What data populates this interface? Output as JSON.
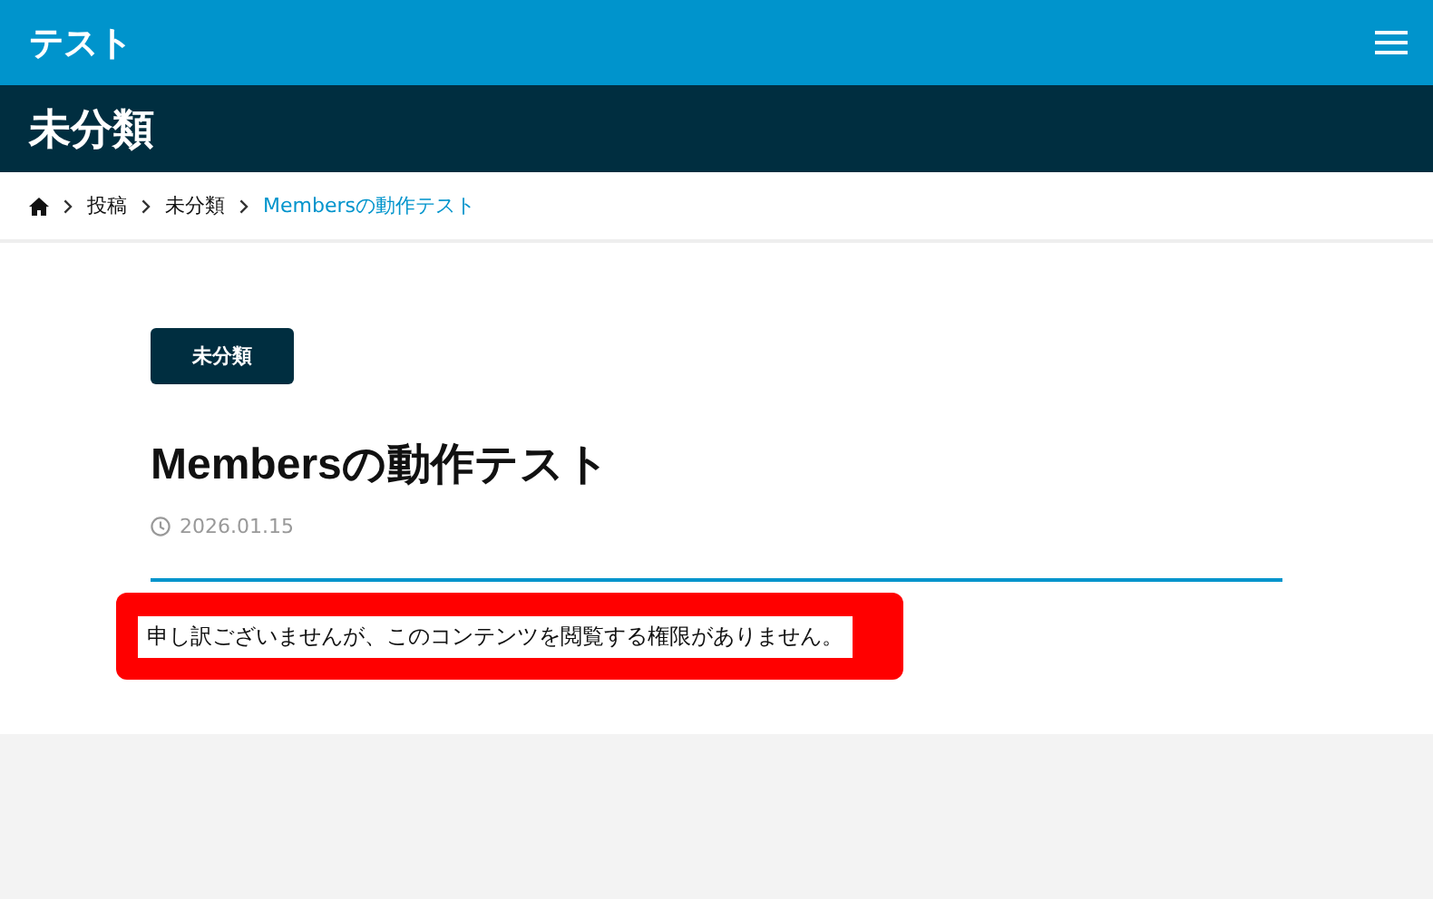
{
  "header": {
    "site_title": "テスト"
  },
  "category_bar": {
    "title": "未分類"
  },
  "breadcrumb": [
    {
      "label": "投稿",
      "current": false
    },
    {
      "label": "未分類",
      "current": false
    },
    {
      "label": "Membersの動作テスト",
      "current": true
    }
  ],
  "post": {
    "category": "未分類",
    "title": "Membersの動作テスト",
    "date": "2026.01.15",
    "notice": "申し訳ございませんが、このコンテンツを閲覧する権限がありません。"
  }
}
